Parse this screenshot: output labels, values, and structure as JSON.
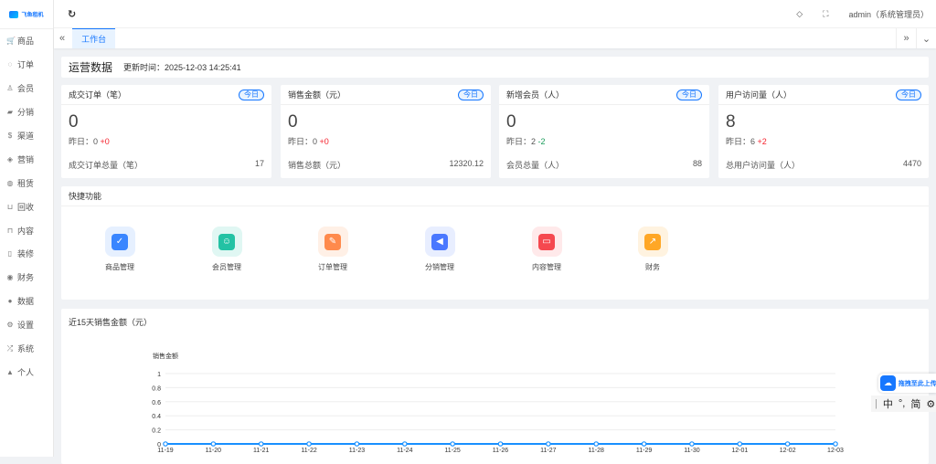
{
  "logo": {
    "text": "飞鱼租机"
  },
  "sidebar": {
    "items": [
      {
        "label": "商品",
        "icon": "cart-icon",
        "glyph": "🛒"
      },
      {
        "label": "订单",
        "icon": "bell-icon",
        "glyph": "◌"
      },
      {
        "label": "会员",
        "icon": "user-icon",
        "glyph": "♙"
      },
      {
        "label": "分销",
        "icon": "graduation-cap-icon",
        "glyph": "▰"
      },
      {
        "label": "渠道",
        "icon": "dollar-icon",
        "glyph": "$"
      },
      {
        "label": "营销",
        "icon": "gem-icon",
        "glyph": "◈"
      },
      {
        "label": "租赁",
        "icon": "shield-icon",
        "glyph": "◍"
      },
      {
        "label": "回收",
        "icon": "cart-icon",
        "glyph": "⊔"
      },
      {
        "label": "内容",
        "icon": "car-icon",
        "glyph": "⊓"
      },
      {
        "label": "装修",
        "icon": "tablet-icon",
        "glyph": "▯"
      },
      {
        "label": "财务",
        "icon": "coin-icon",
        "glyph": "◉"
      },
      {
        "label": "数据",
        "icon": "globe-icon",
        "glyph": "●"
      },
      {
        "label": "设置",
        "icon": "gear-icon",
        "glyph": "⚙"
      },
      {
        "label": "系统",
        "icon": "shuffle-icon",
        "glyph": "⤮"
      },
      {
        "label": "个人",
        "icon": "person-icon",
        "glyph": "▲"
      }
    ]
  },
  "header": {
    "user": "admin（系统管理员）"
  },
  "tabs": [
    {
      "label": "工作台"
    }
  ],
  "overview": {
    "title": "运营数据",
    "updated_label": "更新时间：",
    "updated": "2025-12-03 14:25:41"
  },
  "cards": [
    {
      "title": "成交订单（笔）",
      "badge": "今日",
      "value": "0",
      "y_label": "昨日：",
      "y_value": "0",
      "delta": "+0",
      "trend": "up",
      "total_label": "成交订单总量（笔）",
      "total": "17"
    },
    {
      "title": "销售金额（元）",
      "badge": "今日",
      "value": "0",
      "y_label": "昨日：",
      "y_value": "0",
      "delta": "+0",
      "trend": "up",
      "total_label": "销售总额（元）",
      "total": "12320.12"
    },
    {
      "title": "新增会员（人）",
      "badge": "今日",
      "value": "0",
      "y_label": "昨日：",
      "y_value": "2",
      "delta": "-2",
      "trend": "down",
      "total_label": "会员总量（人）",
      "total": "88"
    },
    {
      "title": "用户访问量（人）",
      "badge": "今日",
      "value": "8",
      "y_label": "昨日：",
      "y_value": "6",
      "delta": "+2",
      "trend": "up",
      "total_label": "总用户访问量（人）",
      "total": "4470"
    }
  ],
  "quick": {
    "title": "快捷功能",
    "items": [
      {
        "label": "商品管理",
        "bg": "#e6f0ff",
        "fg": "#3a86ff",
        "glyph": "✓"
      },
      {
        "label": "会员管理",
        "bg": "#e0f7f3",
        "fg": "#23c2a4",
        "glyph": "☺"
      },
      {
        "label": "订单管理",
        "bg": "#fff0e6",
        "fg": "#ff8a4c",
        "glyph": "✎"
      },
      {
        "label": "分销管理",
        "bg": "#e8eeff",
        "fg": "#4a78ff",
        "glyph": "◀"
      },
      {
        "label": "内容管理",
        "bg": "#ffe9ea",
        "fg": "#f5484f",
        "glyph": "▭"
      },
      {
        "label": "财务",
        "bg": "#fff3e0",
        "fg": "#ffa726",
        "glyph": "↗"
      }
    ]
  },
  "chart_data": {
    "type": "line",
    "title": "近15天销售金额（元）",
    "ylabel": "销售金额",
    "ylim": [
      0,
      1
    ],
    "yticks": [
      "0",
      "0.2",
      "0.4",
      "0.6",
      "0.8",
      "1"
    ],
    "x": [
      "11-19",
      "11-20",
      "11-21",
      "11-22",
      "11-23",
      "11-24",
      "11-25",
      "11-26",
      "11-27",
      "11-28",
      "11-29",
      "11-30",
      "12-01",
      "12-02",
      "12-03"
    ],
    "values": [
      0,
      0,
      0,
      0,
      0,
      0,
      0,
      0,
      0,
      0,
      0,
      0,
      0,
      0,
      0
    ],
    "color": "#1890ff"
  },
  "float": {
    "upload": "拖拽至此上传"
  },
  "ime": {
    "items": [
      "中",
      "°,",
      "简",
      "⚙"
    ]
  }
}
